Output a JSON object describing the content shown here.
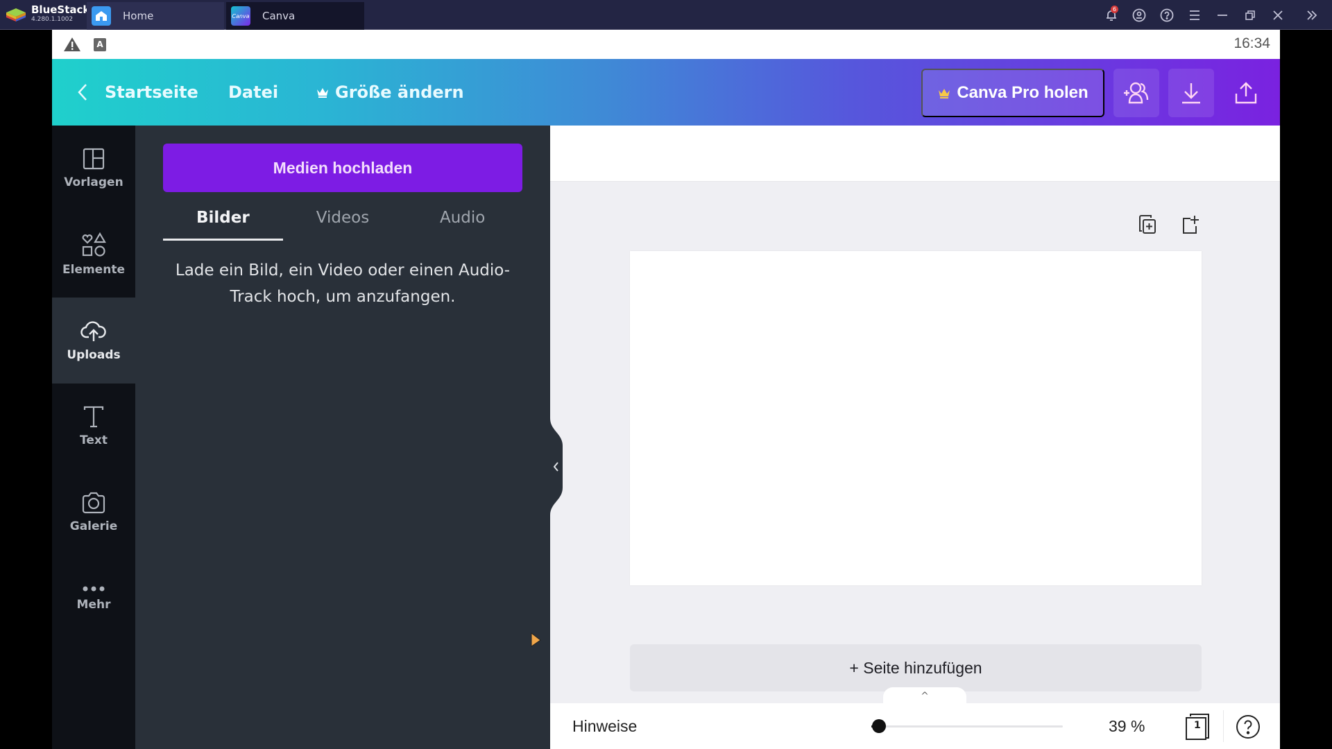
{
  "emulator": {
    "brand": "BlueStacks",
    "version": "4.280.1.1002",
    "tabs": [
      {
        "label": "Home",
        "icon": "home-icon"
      },
      {
        "label": "Canva",
        "icon": "canva-logo-icon",
        "active": true
      }
    ],
    "notification_count": "6",
    "controls": [
      "bell-icon",
      "account-icon",
      "help-icon",
      "menu-icon",
      "minimize-icon",
      "restore-icon",
      "close-icon",
      "expand-sidebar-icon"
    ]
  },
  "status_bar": {
    "time": "16:34",
    "icons": [
      "warning-icon",
      "keyboard-a-icon"
    ]
  },
  "header": {
    "back_label": "Startseite",
    "file_label": "Datei",
    "resize_label": "Größe ändern",
    "pro_label": "Canva Pro holen",
    "actions": [
      "share-people-icon",
      "download-icon",
      "publish-upload-icon"
    ],
    "brand_colors": {
      "start": "#1fd0cc",
      "end": "#7a22e0"
    }
  },
  "sidebar": {
    "items": [
      {
        "label": "Vorlagen",
        "icon": "templates-icon"
      },
      {
        "label": "Elemente",
        "icon": "elements-icon"
      },
      {
        "label": "Uploads",
        "icon": "cloud-upload-icon",
        "active": true
      },
      {
        "label": "Text",
        "icon": "text-icon"
      },
      {
        "label": "Galerie",
        "icon": "camera-icon"
      },
      {
        "label": "Mehr",
        "icon": "more-dots-icon"
      }
    ]
  },
  "panel": {
    "upload_button": "Medien hochladen",
    "accent": "#7d1ce4",
    "tabs": [
      {
        "label": "Bilder",
        "active": true
      },
      {
        "label": "Videos"
      },
      {
        "label": "Audio"
      }
    ],
    "empty_message": "Lade ein Bild, ein Video oder einen Audio-Track hoch, um anzufangen."
  },
  "canvas": {
    "page_tools": [
      "duplicate-page-icon",
      "add-page-icon"
    ],
    "add_page_label": "+ Seite hinzufügen",
    "expand_label": "^"
  },
  "footer": {
    "hints_label": "Hinweise",
    "zoom_percent": 39,
    "zoom_label": "39 %",
    "zoom_slider_fraction": 0.04,
    "page_count": "1"
  }
}
